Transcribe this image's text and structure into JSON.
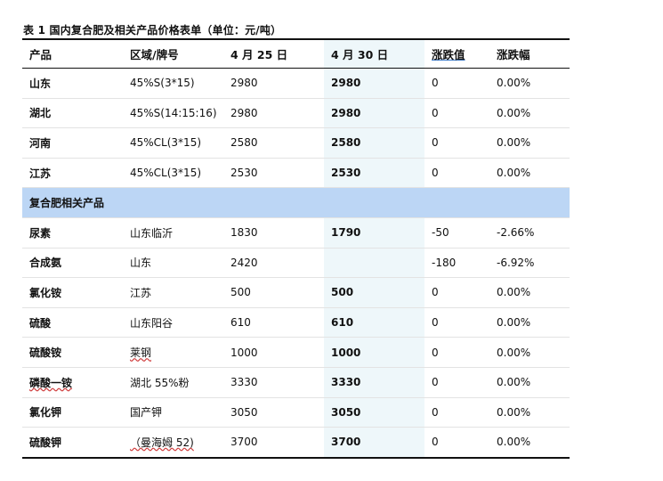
{
  "caption": "表 1 国内复合肥及相关产品价格表单（单位：元/吨）",
  "headers": [
    "产品",
    "区域/牌号",
    "4 月 25 日",
    "4 月 30 日",
    "涨跌值",
    "涨跌幅"
  ],
  "compound_rows": [
    {
      "product": "山东",
      "spec": "45%S(3*15)",
      "apr25": "2980",
      "apr30": "2980",
      "change": "0",
      "pct": "0.00%"
    },
    {
      "product": "湖北",
      "spec": "45%S(14:15:16)",
      "apr25": "2980",
      "apr30": "2980",
      "change": "0",
      "pct": "0.00%"
    },
    {
      "product": "河南",
      "spec": "45%CL(3*15)",
      "apr25": "2580",
      "apr30": "2580",
      "change": "0",
      "pct": "0.00%"
    },
    {
      "product": "江苏",
      "spec": "45%CL(3*15)",
      "apr25": "2530",
      "apr30": "2530",
      "change": "0",
      "pct": "0.00%"
    }
  ],
  "section_title": "复合肥相关产品",
  "related_rows": [
    {
      "product": "尿素",
      "spec": "山东临沂",
      "apr25": "1830",
      "apr30": "1790",
      "change": "-50",
      "pct": "-2.66%"
    },
    {
      "product": "合成氨",
      "spec": "山东",
      "apr25": "2420",
      "apr30": "",
      "change": "-180",
      "pct": "-6.92%"
    },
    {
      "product": "氯化铵",
      "spec": "江苏",
      "apr25": "500",
      "apr30": "500",
      "change": "0",
      "pct": "0.00%"
    },
    {
      "product": "硫酸",
      "spec": "山东阳谷",
      "apr25": "610",
      "apr30": "610",
      "change": "0",
      "pct": "0.00%"
    },
    {
      "product": "硫酸铵",
      "spec": "莱钢",
      "apr25": "1000",
      "apr30": "1000",
      "change": "0",
      "pct": "0.00%"
    },
    {
      "product": "磷酸一铵",
      "spec": "湖北 55%粉",
      "apr25": "3330",
      "apr30": "3330",
      "change": "0",
      "pct": "0.00%"
    },
    {
      "product": "氯化钾",
      "spec": "国产钾",
      "apr25": "3050",
      "apr30": "3050",
      "change": "0",
      "pct": "0.00%"
    },
    {
      "product": "硫酸钾",
      "spec": "（曼海姆 52)",
      "apr25": "3700",
      "apr30": "3700",
      "change": "0",
      "pct": "0.00%"
    }
  ]
}
